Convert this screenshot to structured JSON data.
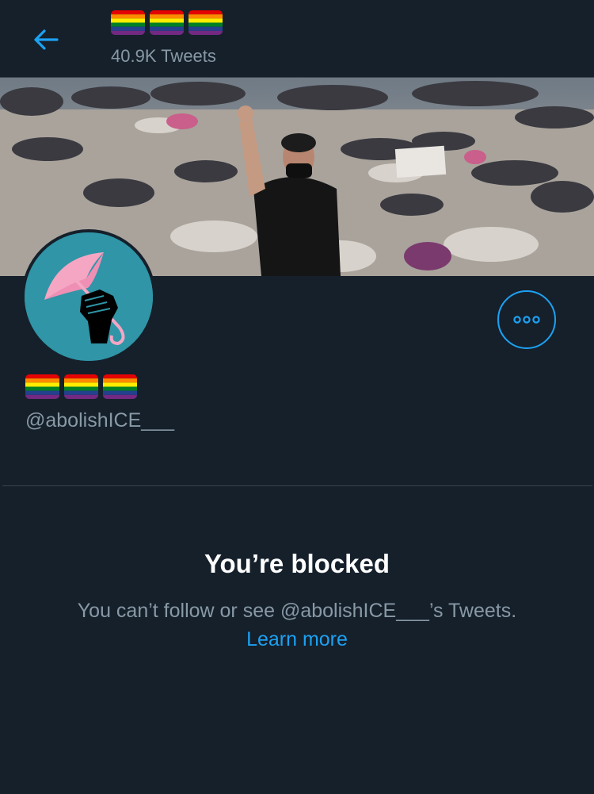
{
  "header": {
    "back_icon": "arrow-left-icon",
    "title_flags": [
      "rainbow-flag",
      "rainbow-flag",
      "rainbow-flag"
    ],
    "tweet_count": "40.9K Tweets"
  },
  "profile": {
    "banner_alt": "banner-photo",
    "avatar_icon": "umbrella-fist-icon",
    "name_flags": [
      "rainbow-flag",
      "rainbow-flag",
      "rainbow-flag"
    ],
    "handle": "@abolishICE___",
    "more_icon": "more-horizontal-icon"
  },
  "blocked": {
    "title": "You’re blocked",
    "message": "You can’t follow or see @abolishICE___’s Tweets.",
    "link": "Learn more"
  },
  "colors": {
    "background": "#15202b",
    "accent": "#1da1f2",
    "secondary_text": "#8899a6",
    "avatar_bg": "#2f95a7"
  }
}
